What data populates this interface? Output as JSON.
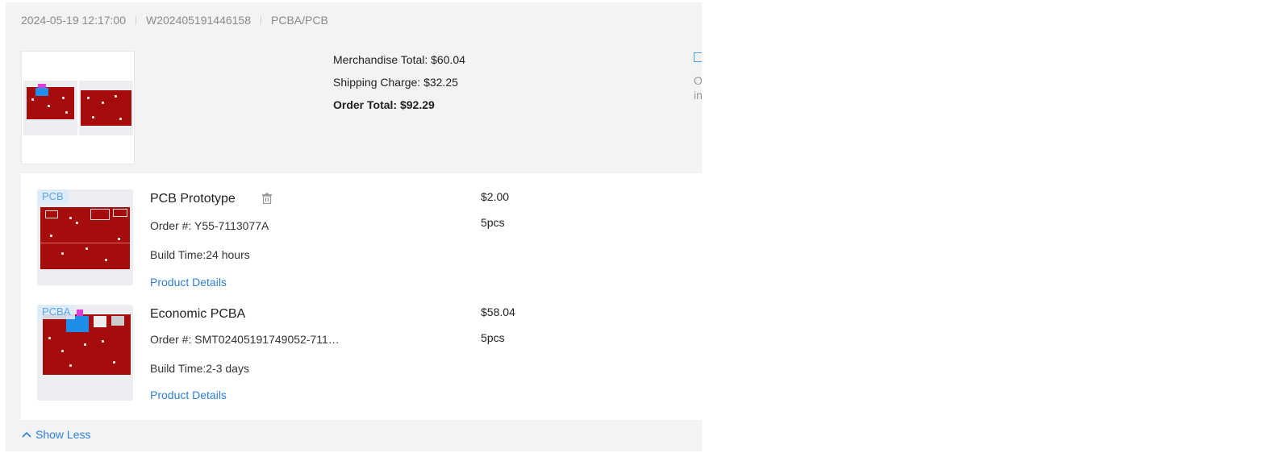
{
  "order_header": {
    "datetime": "2024-05-19 12:17:00",
    "order_id": "W202405191446158",
    "category": "PCBA/PCB"
  },
  "totals": {
    "merchandise": "Merchandise Total: $60.04",
    "shipping": "Shipping Charge: $32.25",
    "order_total": "Order Total: $92.29"
  },
  "side_clipped": {
    "line1": "O",
    "line2": "in"
  },
  "items": [
    {
      "tag": "PCB",
      "name": "PCB Prototype",
      "order": "Order #: Y55-7113077A",
      "build": "Build Time:24 hours",
      "details": "Product Details",
      "price": "$2.00",
      "qty": "5pcs"
    },
    {
      "tag": "PCBA",
      "name": "Economic PCBA",
      "order": "Order #: SMT02405191749052-711…",
      "build": "Build Time:2-3 days",
      "details": "Product Details",
      "price": "$58.04",
      "qty": "5pcs"
    }
  ],
  "show_less": "Show Less",
  "colors": {
    "panel_bg": "#f2f3f5",
    "link": "#2f80d6",
    "pcb_red": "#a50d0d",
    "tag_blue": "#5aa6ee"
  }
}
